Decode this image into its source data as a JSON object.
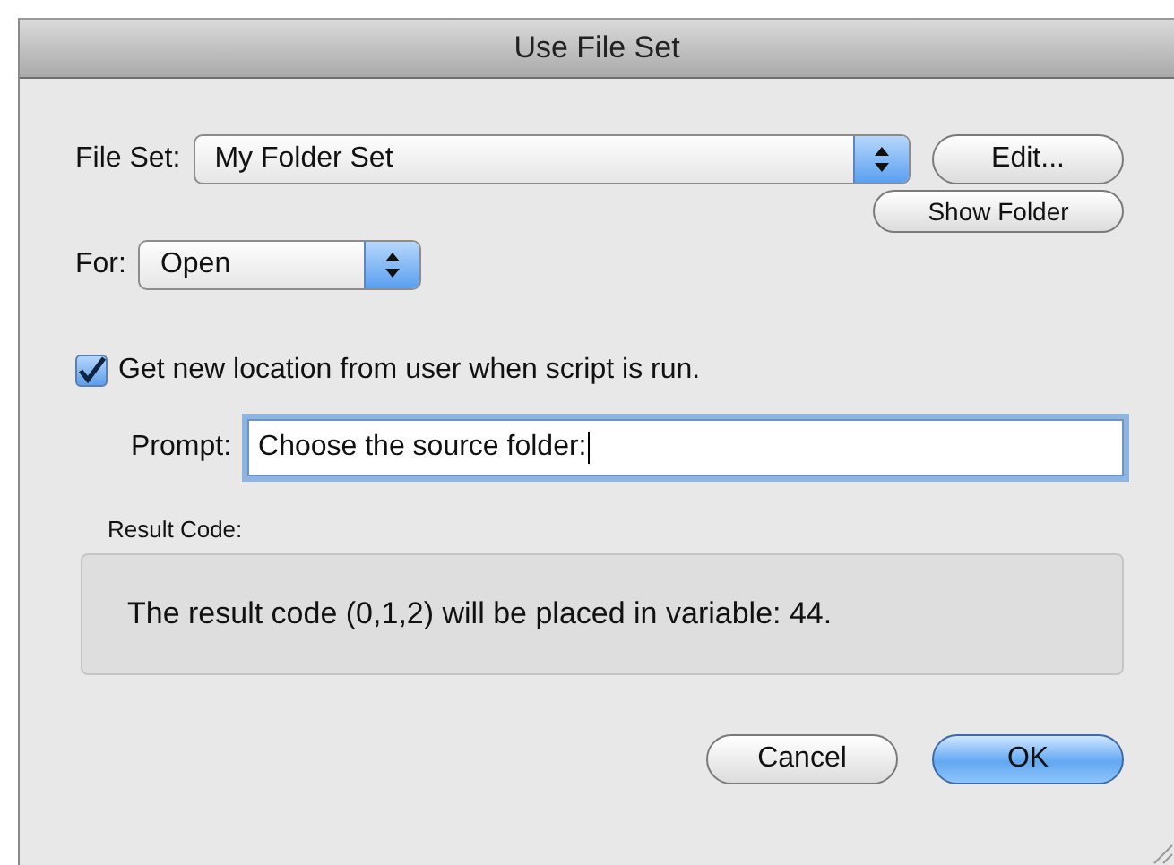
{
  "window": {
    "title": "Use File Set"
  },
  "file_set": {
    "label": "File Set:",
    "value": "My Folder Set"
  },
  "edit_button": {
    "label": "Edit..."
  },
  "show_folder_button": {
    "label": "Show Folder"
  },
  "for": {
    "label": "For:",
    "value": "Open"
  },
  "checkbox": {
    "label": "Get new location from user when script is run.",
    "checked": true
  },
  "prompt": {
    "label": "Prompt:",
    "value": "Choose the source folder:",
    "focused": true
  },
  "result": {
    "label": "Result Code:",
    "text": "The result code (0,1,2) will be placed in variable: 44."
  },
  "buttons": [
    {
      "label": "Cancel",
      "kind": "normal"
    },
    {
      "label": "OK",
      "kind": "default"
    }
  ]
}
